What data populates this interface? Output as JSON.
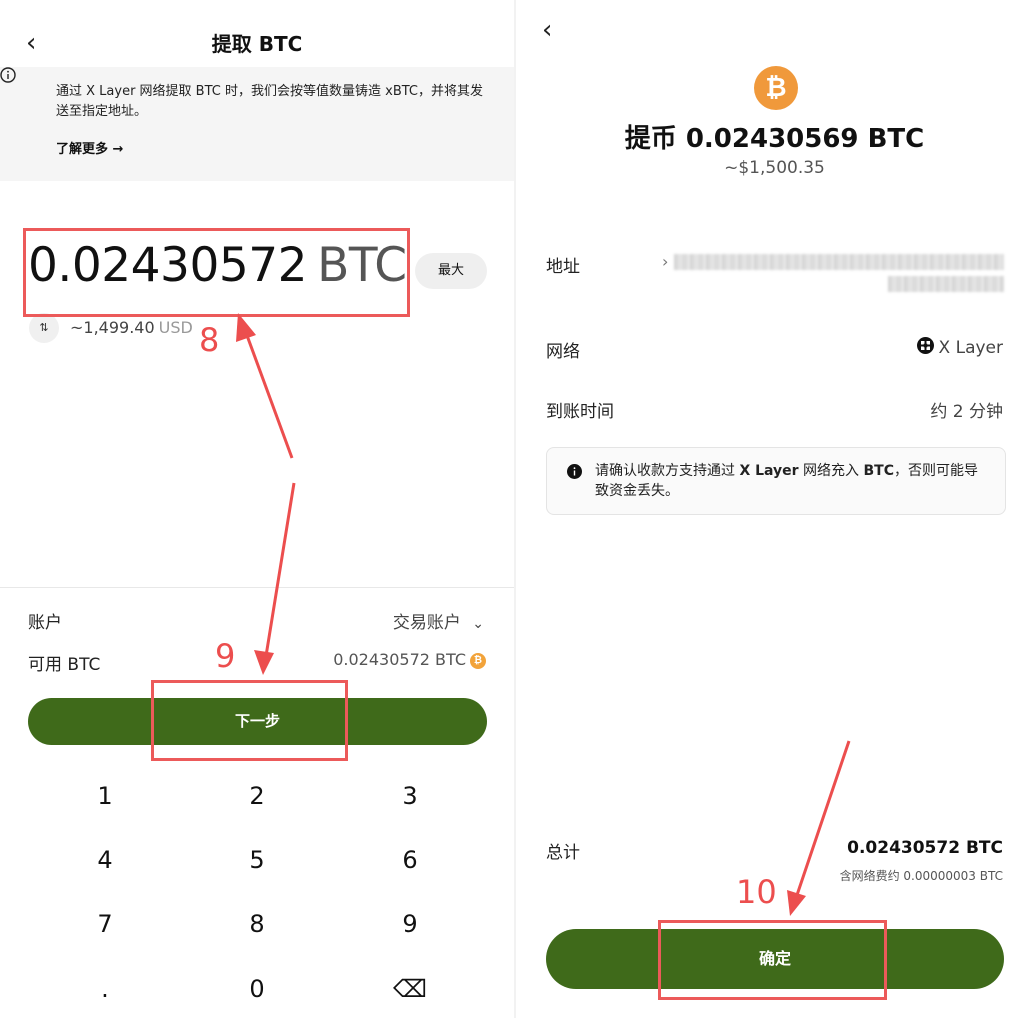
{
  "left": {
    "back_icon": "chevron-left-icon",
    "title": "提取 BTC",
    "notice": {
      "text": "通过 X Layer 网络提取 BTC 时，我们会按等值数量铸造 xBTC，并将其发送至指定地址。",
      "learn_more": "了解更多 →"
    },
    "amount": "0.02430572",
    "amount_currency": "BTC",
    "max_label": "最大",
    "swap_icon_label": "⇅",
    "usd_value": "~1,499.40",
    "usd_unit": "USD",
    "account_label": "账户",
    "account_value": "交易账户",
    "available_label": "可用 BTC",
    "available_value": "0.02430572 BTC",
    "next_label": "下一步",
    "keypad": [
      "1",
      "2",
      "3",
      "4",
      "5",
      "6",
      "7",
      "8",
      "9",
      ".",
      "0",
      "⌫"
    ]
  },
  "right": {
    "back_icon": "chevron-left-icon",
    "coin_symbol": "₿",
    "withdraw_title": "提币 0.02430569 BTC",
    "withdraw_usd": "~$1,500.35",
    "address_label": "地址",
    "address_prefix": "›",
    "network_label": "网络",
    "network_value": "X Layer",
    "arrival_label": "到账时间",
    "arrival_value": "约 2 分钟",
    "warning_pre": "请确认收款方支持通过 ",
    "warning_network": "X Layer",
    "warning_mid": " 网络充入 ",
    "warning_coin": "BTC",
    "warning_post": "，否则可能导致资金丢失。",
    "total_label": "总计",
    "total_value": "0.02430572 BTC",
    "fee_text": "含网络费约 0.00000003 BTC",
    "confirm_label": "确定"
  },
  "annotations": {
    "step8": "8",
    "step9": "9",
    "step10": "10",
    "color": "#ec4e4e"
  },
  "colors": {
    "primary_button": "#3f6a1a",
    "btc_orange": "#f0993b"
  }
}
